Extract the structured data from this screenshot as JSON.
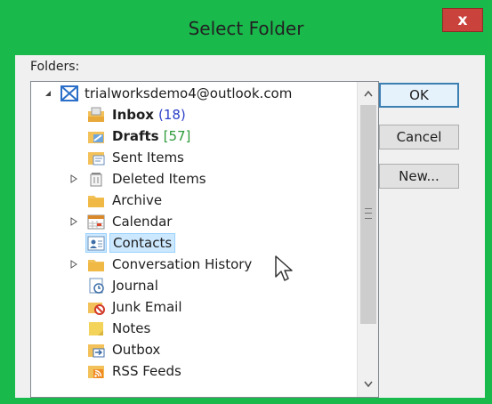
{
  "window": {
    "title": "Select Folder",
    "close_glyph": "x"
  },
  "folders_label": "Folders:",
  "tree": {
    "account": {
      "label": "trialworksdemo4@outlook.com",
      "icon": "account-icon",
      "expanded": true
    },
    "items": [
      {
        "name": "Inbox",
        "count": "(18)",
        "count_style": "blue",
        "bold": true,
        "icon": "inbox-icon",
        "has_children": false
      },
      {
        "name": "Drafts",
        "count": "[57]",
        "count_style": "green",
        "bold": true,
        "icon": "drafts-icon",
        "has_children": false
      },
      {
        "name": "Sent Items",
        "count": "",
        "bold": false,
        "icon": "sent-items-icon",
        "has_children": false
      },
      {
        "name": "Deleted Items",
        "count": "",
        "bold": false,
        "icon": "deleted-items-icon",
        "has_children": true
      },
      {
        "name": "Archive",
        "count": "",
        "bold": false,
        "icon": "folder-icon",
        "has_children": false
      },
      {
        "name": "Calendar",
        "count": "",
        "bold": false,
        "icon": "calendar-icon",
        "has_children": true
      },
      {
        "name": "Contacts",
        "count": "",
        "bold": false,
        "icon": "contacts-icon",
        "has_children": false,
        "selected": true
      },
      {
        "name": "Conversation History",
        "count": "",
        "bold": false,
        "icon": "folder-icon",
        "has_children": true
      },
      {
        "name": "Journal",
        "count": "",
        "bold": false,
        "icon": "journal-icon",
        "has_children": false
      },
      {
        "name": "Junk Email",
        "count": "",
        "bold": false,
        "icon": "junk-email-icon",
        "has_children": false
      },
      {
        "name": "Notes",
        "count": "",
        "bold": false,
        "icon": "notes-icon",
        "has_children": false
      },
      {
        "name": "Outbox",
        "count": "",
        "bold": false,
        "icon": "outbox-icon",
        "has_children": false
      },
      {
        "name": "RSS Feeds",
        "count": "",
        "bold": false,
        "icon": "rss-icon",
        "has_children": false
      }
    ]
  },
  "buttons": {
    "ok": "OK",
    "cancel": "Cancel",
    "new": "New..."
  },
  "colors": {
    "frame": "#19b94c",
    "close": "#c9423c",
    "selection": "#cce8ff",
    "count_blue": "#2b3fc8",
    "count_green": "#2e9a3a"
  }
}
